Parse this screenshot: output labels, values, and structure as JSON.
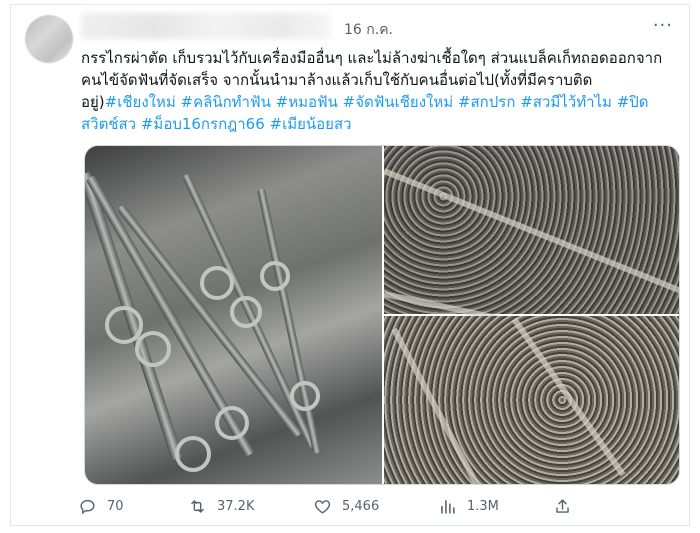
{
  "tweet": {
    "date": "16 ก.ค.",
    "more_label": "···",
    "text_plain": "กรรไกรผ่าตัด เก็บรวมไว้กับเครื่องมืออื่นๆ และไม่ล้างฆ่าเชื้อใดๆ ส่วนแบล็คเก็ทถอดออกจากคนไข้จัดฟันที่จัดเสร็จ จากนั้นนำมาล้างแล้วเก็บใช้กับคนอื่นต่อไป(ทั้งที่มีคราบติดอยู่)",
    "hashtags": [
      "#เชียงใหม่",
      "#คลินิกทำฟัน",
      "#หมอฟัน",
      "#จัดฟันเชียงใหม่",
      "#สกปรก",
      "#สวมีไว้ทำไม",
      "#ปิดสวิตช์สว",
      "#ม็อบ16กรกฎา66",
      "#เมียน้อยสว"
    ]
  },
  "media": {
    "images": [
      {
        "name": "surgical-tools-tray"
      },
      {
        "name": "brackets-top"
      },
      {
        "name": "brackets-bottom"
      }
    ]
  },
  "actions": {
    "replies": "70",
    "retweets": "37.2K",
    "likes": "5,466",
    "views": "1.3M"
  },
  "icons": {
    "reply": "reply-icon",
    "retweet": "retweet-icon",
    "like": "heart-icon",
    "views": "views-icon",
    "share": "share-icon"
  },
  "colors": {
    "hashtag": "#1d9bf0",
    "secondary_text": "#536471"
  }
}
